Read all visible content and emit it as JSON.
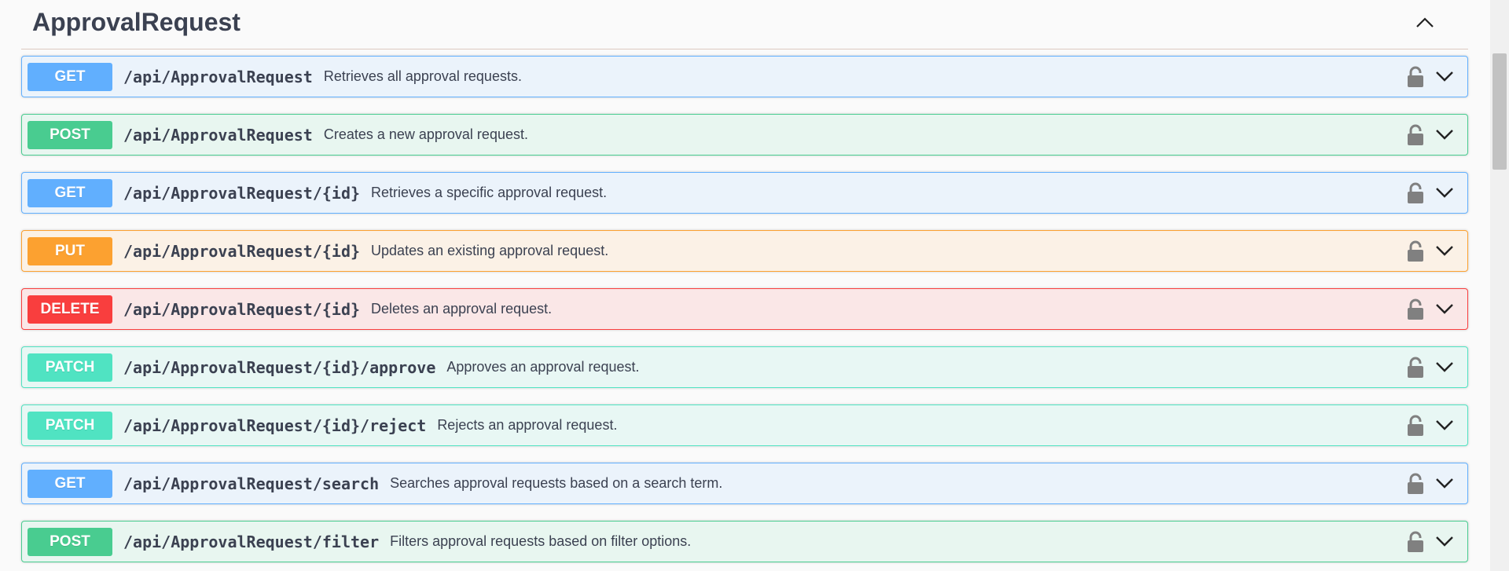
{
  "section": {
    "title": "ApprovalRequest",
    "collapse_icon": "chevron-up-icon"
  },
  "operations": [
    {
      "method": "GET",
      "path": "/api/ApprovalRequest",
      "description": "Retrieves all approval requests."
    },
    {
      "method": "POST",
      "path": "/api/ApprovalRequest",
      "description": "Creates a new approval request."
    },
    {
      "method": "GET",
      "path": "/api/ApprovalRequest/{id}",
      "description": "Retrieves a specific approval request."
    },
    {
      "method": "PUT",
      "path": "/api/ApprovalRequest/{id}",
      "description": "Updates an existing approval request."
    },
    {
      "method": "DELETE",
      "path": "/api/ApprovalRequest/{id}",
      "description": "Deletes an approval request."
    },
    {
      "method": "PATCH",
      "path": "/api/ApprovalRequest/{id}/approve",
      "description": "Approves an approval request."
    },
    {
      "method": "PATCH",
      "path": "/api/ApprovalRequest/{id}/reject",
      "description": "Rejects an approval request."
    },
    {
      "method": "GET",
      "path": "/api/ApprovalRequest/search",
      "description": "Searches approval requests based on a search term."
    },
    {
      "method": "POST",
      "path": "/api/ApprovalRequest/filter",
      "description": "Filters approval requests based on filter options."
    }
  ],
  "icons": {
    "lock": "unlocked-padlock-icon",
    "expand": "chevron-down-icon"
  },
  "colors": {
    "GET": "#61affe",
    "POST": "#49cc90",
    "PUT": "#fca130",
    "DELETE": "#f93e3e",
    "PATCH": "#50e3c2"
  }
}
